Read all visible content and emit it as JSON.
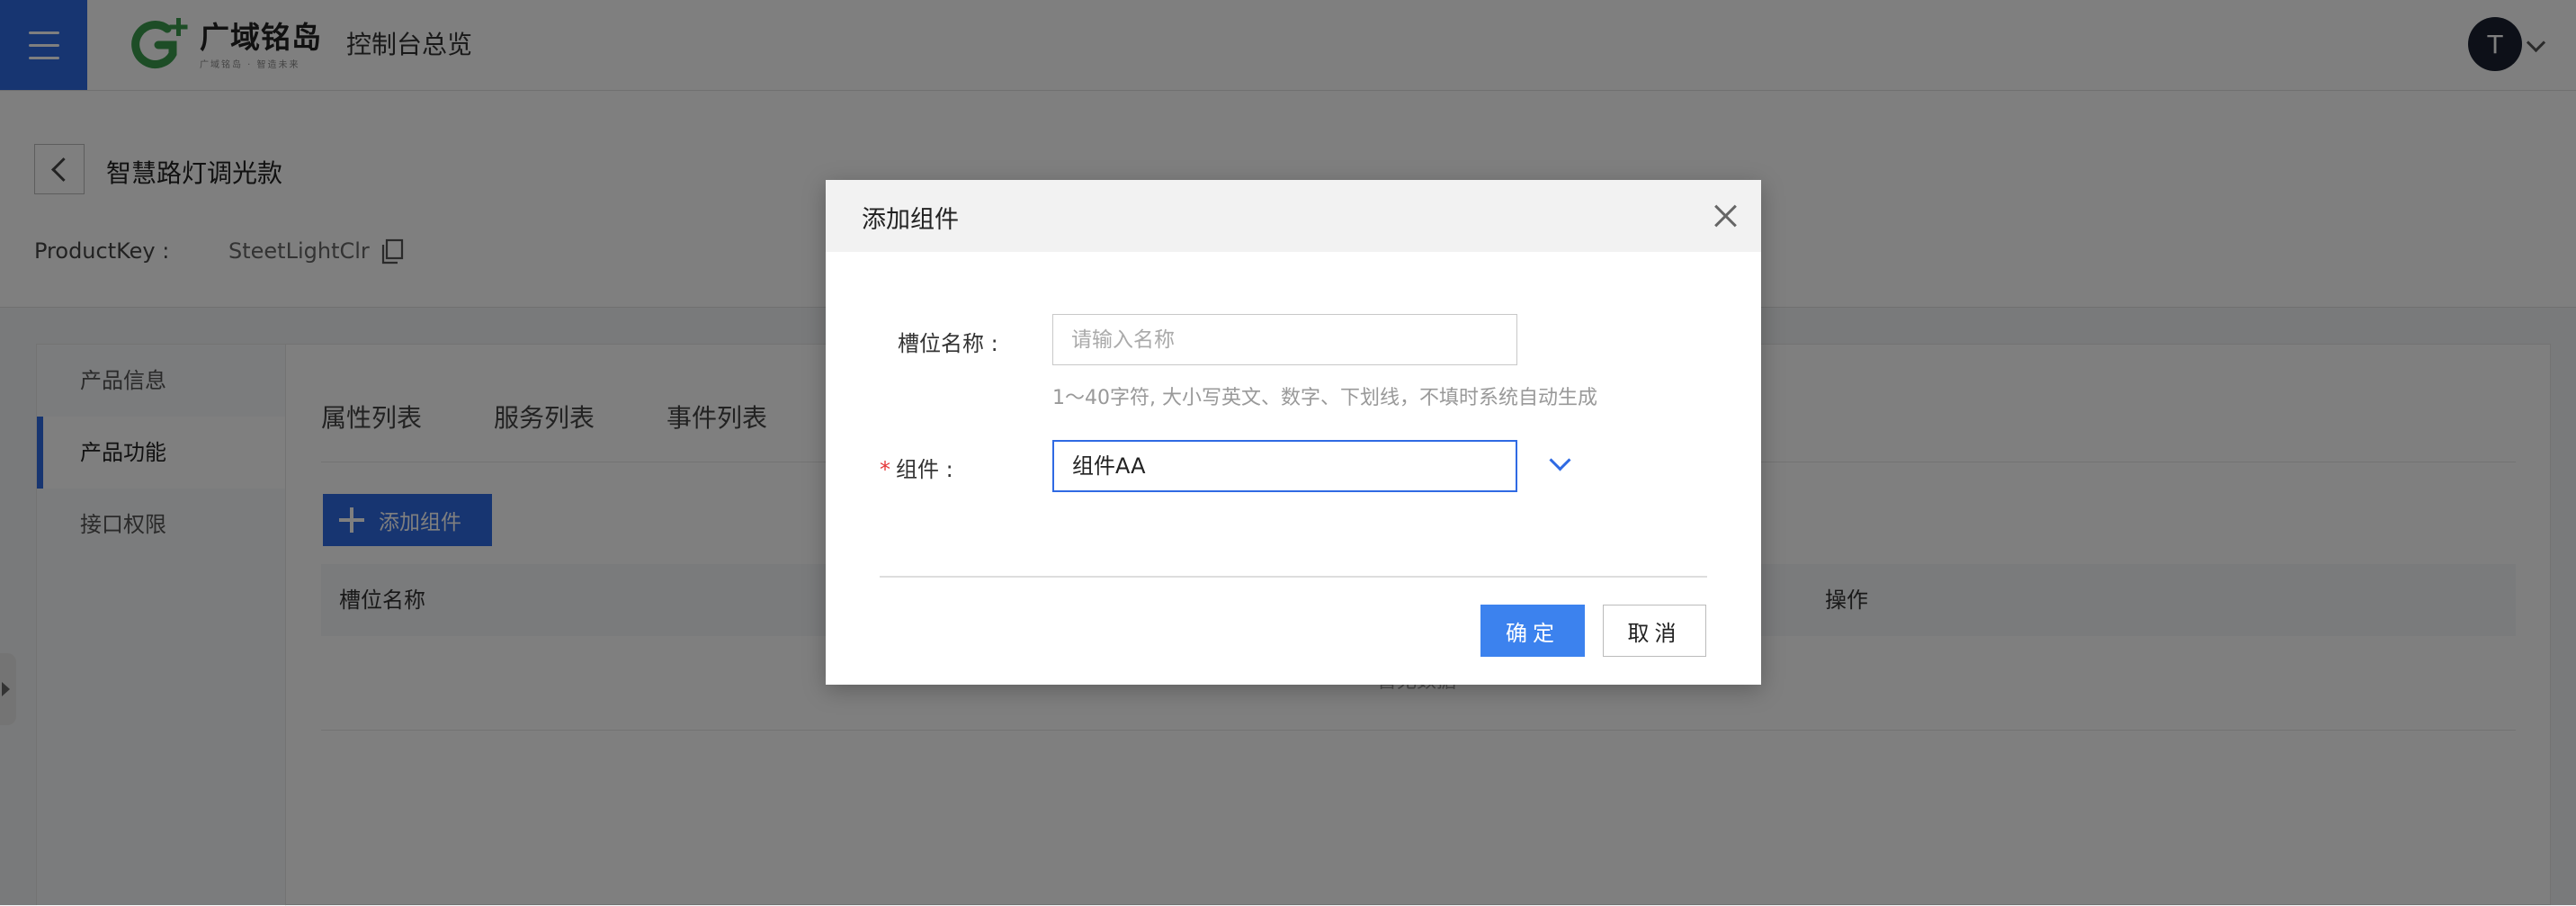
{
  "header": {
    "logo_cn": "广域铭岛",
    "logo_sub": "广域铭岛 · 智造未来",
    "console_title": "控制台总览",
    "avatar_initial": "T"
  },
  "product": {
    "name": "智慧路灯调光款",
    "key_label": "ProductKey :",
    "key_value": "SteetLightClr"
  },
  "sidebar": {
    "items": [
      {
        "label": "产品信息",
        "active": false
      },
      {
        "label": "产品功能",
        "active": true
      },
      {
        "label": "接口权限",
        "active": false
      }
    ]
  },
  "tabs": [
    "属性列表",
    "服务列表",
    "事件列表"
  ],
  "toolbar": {
    "add_label": "添加组件"
  },
  "table": {
    "columns": [
      "槽位名称",
      "操作"
    ],
    "empty_text": "暂无数据"
  },
  "modal": {
    "title": "添加组件",
    "slot_label": "槽位名称 :",
    "slot_placeholder": "请输入名称",
    "slot_value": "",
    "slot_hint": "1～40字符, 大小写英文、数字、下划线，不填时系统自动生成",
    "component_required_mark": "*",
    "component_label": "组件 :",
    "component_value": "组件AA",
    "ok_label": "确定",
    "cancel_label": "取消"
  },
  "colors": {
    "accent": "#2f6ae3",
    "primary_button": "#3c82ee",
    "required": "#e5393a",
    "overlay": "rgba(0,0,0,0.5)"
  }
}
